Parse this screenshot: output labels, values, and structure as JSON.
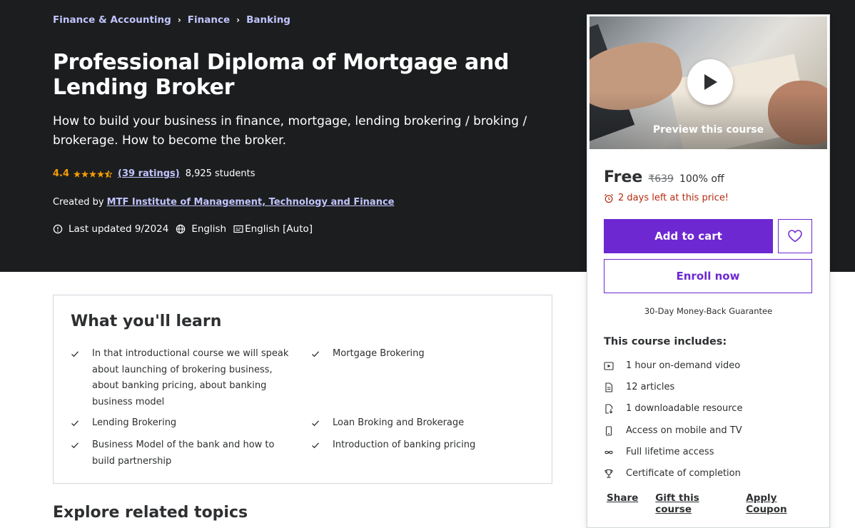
{
  "breadcrumb": [
    "Finance & Accounting",
    "Finance",
    "Banking"
  ],
  "course": {
    "title": "Professional Diploma of Mortgage and Lending Broker",
    "subtitle": "How to build your business in finance, mortgage, lending brokering / broking / brokerage. How to become the broker.",
    "rating": "4.4",
    "rating_stars": 4.5,
    "ratings_count": "(39 ratings)",
    "students": "8,925 students",
    "created_by_label": "Created by",
    "instructor": "MTF Institute of Management, Technology and Finance",
    "last_updated": "Last updated 9/2024",
    "language": "English",
    "captions": "English [Auto]"
  },
  "learn": {
    "title": "What you'll learn",
    "items": [
      "In that introductional course we will speak about launching of brokering business, about banking pricing, about banking business model",
      "Mortgage Brokering",
      "Lending Brokering",
      "Loan Broking and Brokerage",
      "Business Model of the bank and how to build partnership",
      "Introduction of banking pricing"
    ]
  },
  "explore_title": "Explore related topics",
  "sidebar": {
    "preview_label": "Preview this course",
    "price": "Free",
    "original_price": "₹639",
    "discount": "100% off",
    "countdown": "2 days left at this price!",
    "add_to_cart": "Add to cart",
    "enroll_now": "Enroll now",
    "guarantee": "30-Day Money-Back Guarantee",
    "includes_title": "This course includes:",
    "includes": [
      {
        "icon": "video-icon",
        "label": "1 hour on-demand video"
      },
      {
        "icon": "article-icon",
        "label": "12 articles"
      },
      {
        "icon": "download-icon",
        "label": "1 downloadable resource"
      },
      {
        "icon": "mobile-icon",
        "label": "Access on mobile and TV"
      },
      {
        "icon": "infinity-icon",
        "label": "Full lifetime access"
      },
      {
        "icon": "trophy-icon",
        "label": "Certificate of completion"
      }
    ],
    "share": "Share",
    "gift": "Gift this course",
    "coupon": "Apply Coupon"
  },
  "colors": {
    "hero_bg": "#1c1d1f",
    "link_purple": "#c0c4fc",
    "accent": "#6d28d2",
    "rating": "#f69c08",
    "alert": "#b32d0f"
  }
}
